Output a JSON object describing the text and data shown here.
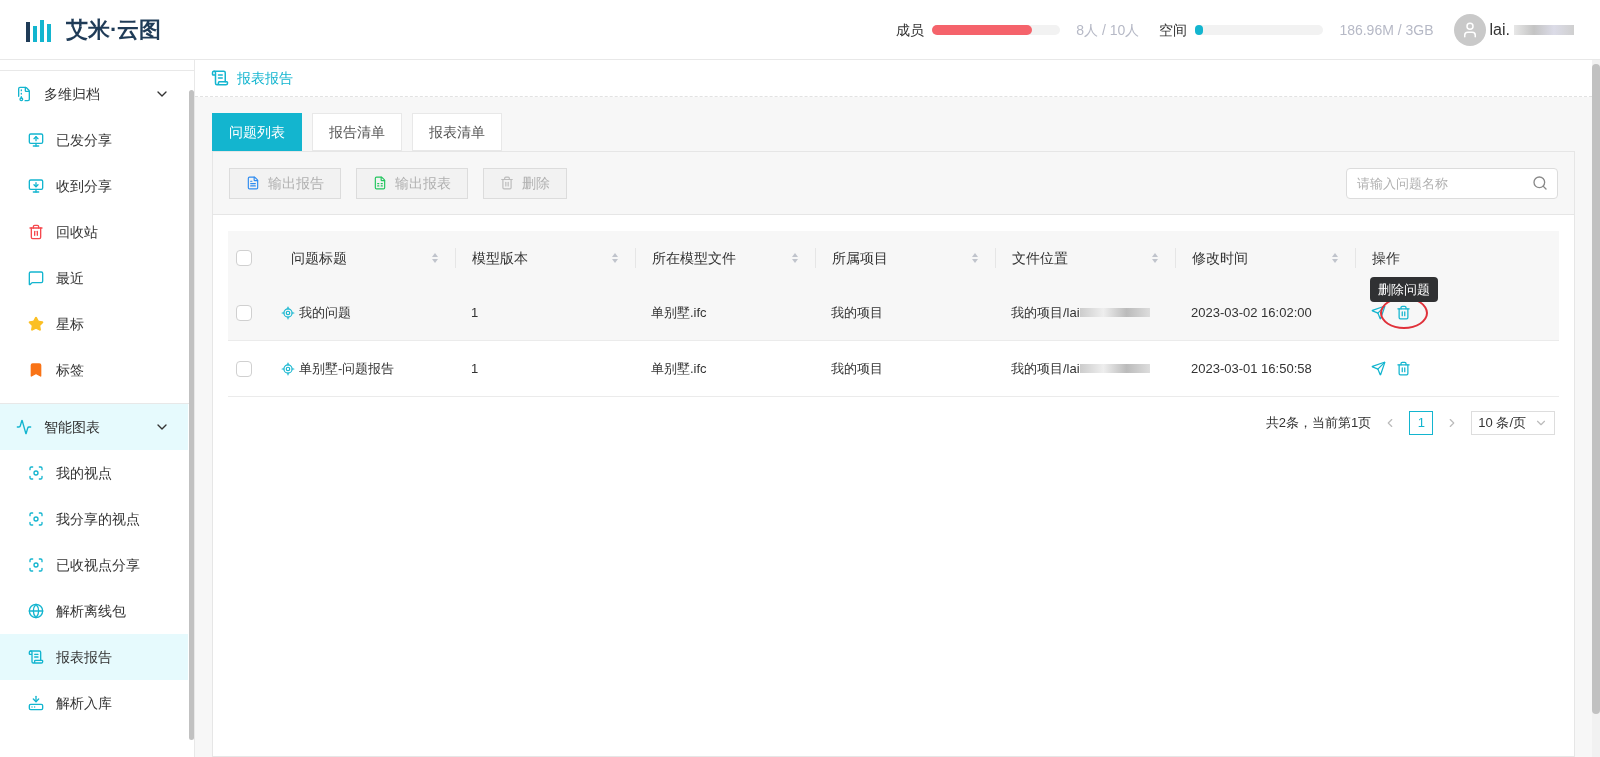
{
  "header": {
    "logo_text": "艾米·云图",
    "members": {
      "label": "成员",
      "level": 0.78,
      "reading": "8人 / 10人"
    },
    "space": {
      "label": "空间",
      "level": 0.03,
      "reading": "186.96M / 3GB"
    },
    "user": {
      "name": "lai."
    }
  },
  "sidebar": {
    "groups": [
      {
        "label": "多维归档",
        "expanded": true,
        "selected": false,
        "children": [
          {
            "label": "已发分享",
            "selected": false
          },
          {
            "label": "收到分享",
            "selected": false
          },
          {
            "label": "回收站",
            "selected": false
          },
          {
            "label": "最近",
            "selected": false
          },
          {
            "label": "星标",
            "selected": false
          },
          {
            "label": "标签",
            "selected": false
          }
        ]
      },
      {
        "label": "智能图表",
        "expanded": true,
        "selected": true,
        "children": [
          {
            "label": "我的视点",
            "selected": false
          },
          {
            "label": "我分享的视点",
            "selected": false
          },
          {
            "label": "已收视点分享",
            "selected": false
          },
          {
            "label": "解析离线包",
            "selected": false
          },
          {
            "label": "报表报告",
            "selected": true
          },
          {
            "label": "解析入库",
            "selected": false
          }
        ]
      }
    ]
  },
  "breadcrumb": "报表报告",
  "tabs": [
    {
      "label": "问题列表",
      "selected": true
    },
    {
      "label": "报告清单",
      "selected": false
    },
    {
      "label": "报表清单",
      "selected": false
    }
  ],
  "toolbar": {
    "buttons": [
      {
        "label": "输出报告",
        "disabled": true
      },
      {
        "label": "输出报表",
        "disabled": true
      },
      {
        "label": "删除",
        "disabled": true
      }
    ],
    "search": {
      "placeholder": "请输入问题名称"
    }
  },
  "table": {
    "columns": [
      "问题标题",
      "模型版本",
      "所在模型文件",
      "所属项目",
      "文件位置",
      "修改时间",
      "操作"
    ],
    "rows": [
      {
        "selected": false,
        "highlighted": true,
        "title": "我的问题",
        "version": "1",
        "file": "单别墅.ifc",
        "project": "我的项目",
        "location": "我的项目/lai",
        "modified": "2023-03-02 16:02:00"
      },
      {
        "selected": false,
        "highlighted": false,
        "title": "单别墅-问题报告",
        "version": "1",
        "file": "单别墅.ifc",
        "project": "我的项目",
        "location": "我的项目/lai",
        "modified": "2023-03-01 16:50:58"
      }
    ],
    "tooltip": "删除问题",
    "all_selected": false
  },
  "pagination": {
    "summary": "共2条，当前第1页",
    "pages": [
      {
        "label": "1",
        "selected": true
      }
    ],
    "page_size": "10 条/页"
  }
}
